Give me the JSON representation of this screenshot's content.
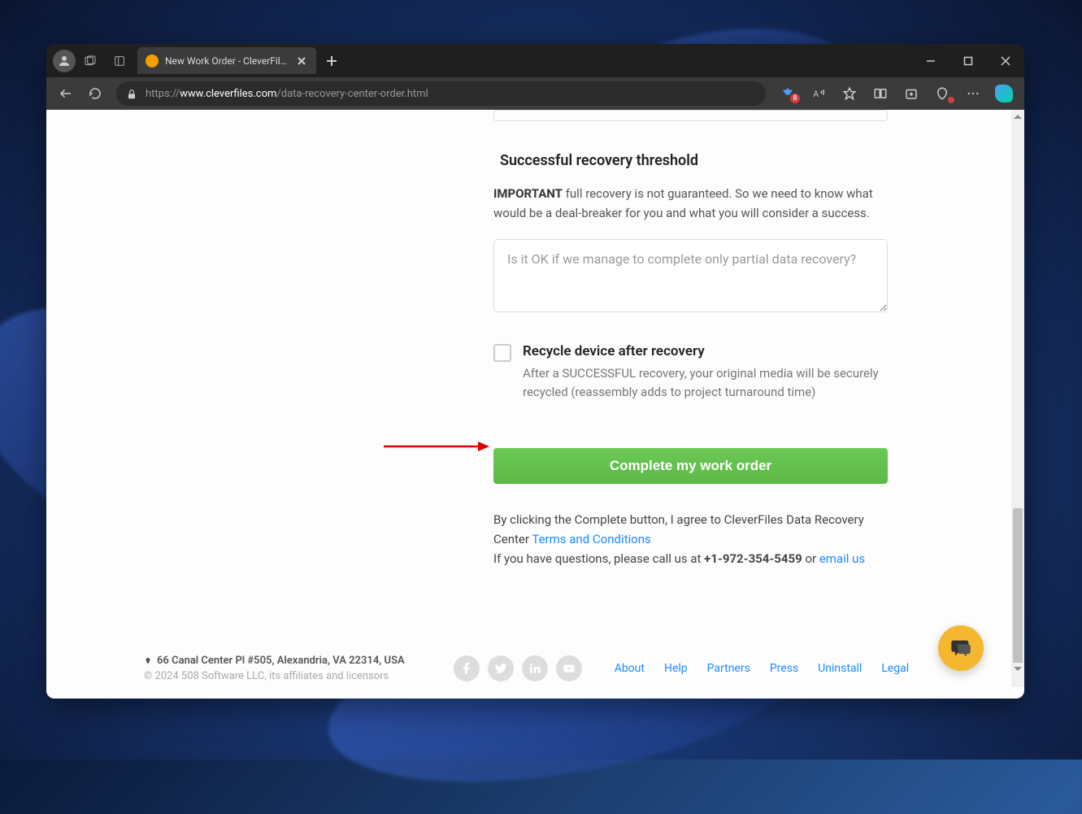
{
  "browser": {
    "tab_title": "New Work Order - CleverFiles Da",
    "url_prefix": "https://",
    "url_domain": "www.cleverfiles.com",
    "url_path": "/data-recovery-center-order.html",
    "badge_count": "8"
  },
  "form": {
    "threshold_title": "Successful recovery threshold",
    "important_label": "IMPORTANT",
    "important_text": " full recovery is not guaranteed. So we need to know what would be a deal-breaker for you and what you will consider a success.",
    "threshold_placeholder": "Is it OK if we manage to complete only partial data recovery?",
    "recycle_label": "Recycle device after recovery",
    "recycle_desc": "After a SUCCESSFUL recovery, your original media will be securely recycled (reassembly adds to project turnaround time)",
    "complete_button": "Complete my work order",
    "agreement_text_1": "By clicking the Complete button, I agree to CleverFiles Data Recovery Center ",
    "terms_link": "Terms and Conditions",
    "questions_text": "If you have questions, please call us at ",
    "phone": "+1-972-354-5459",
    "or_text": " or ",
    "email_link": "email us"
  },
  "footer": {
    "address": "66 Canal Center Pl #505, Alexandria, VA 22314, USA",
    "copyright": "© 2024 508 Software LLC, its affiliates and licensors",
    "links": {
      "about": "About",
      "help": "Help",
      "partners": "Partners",
      "press": "Press",
      "uninstall": "Uninstall",
      "legal": "Legal"
    }
  }
}
